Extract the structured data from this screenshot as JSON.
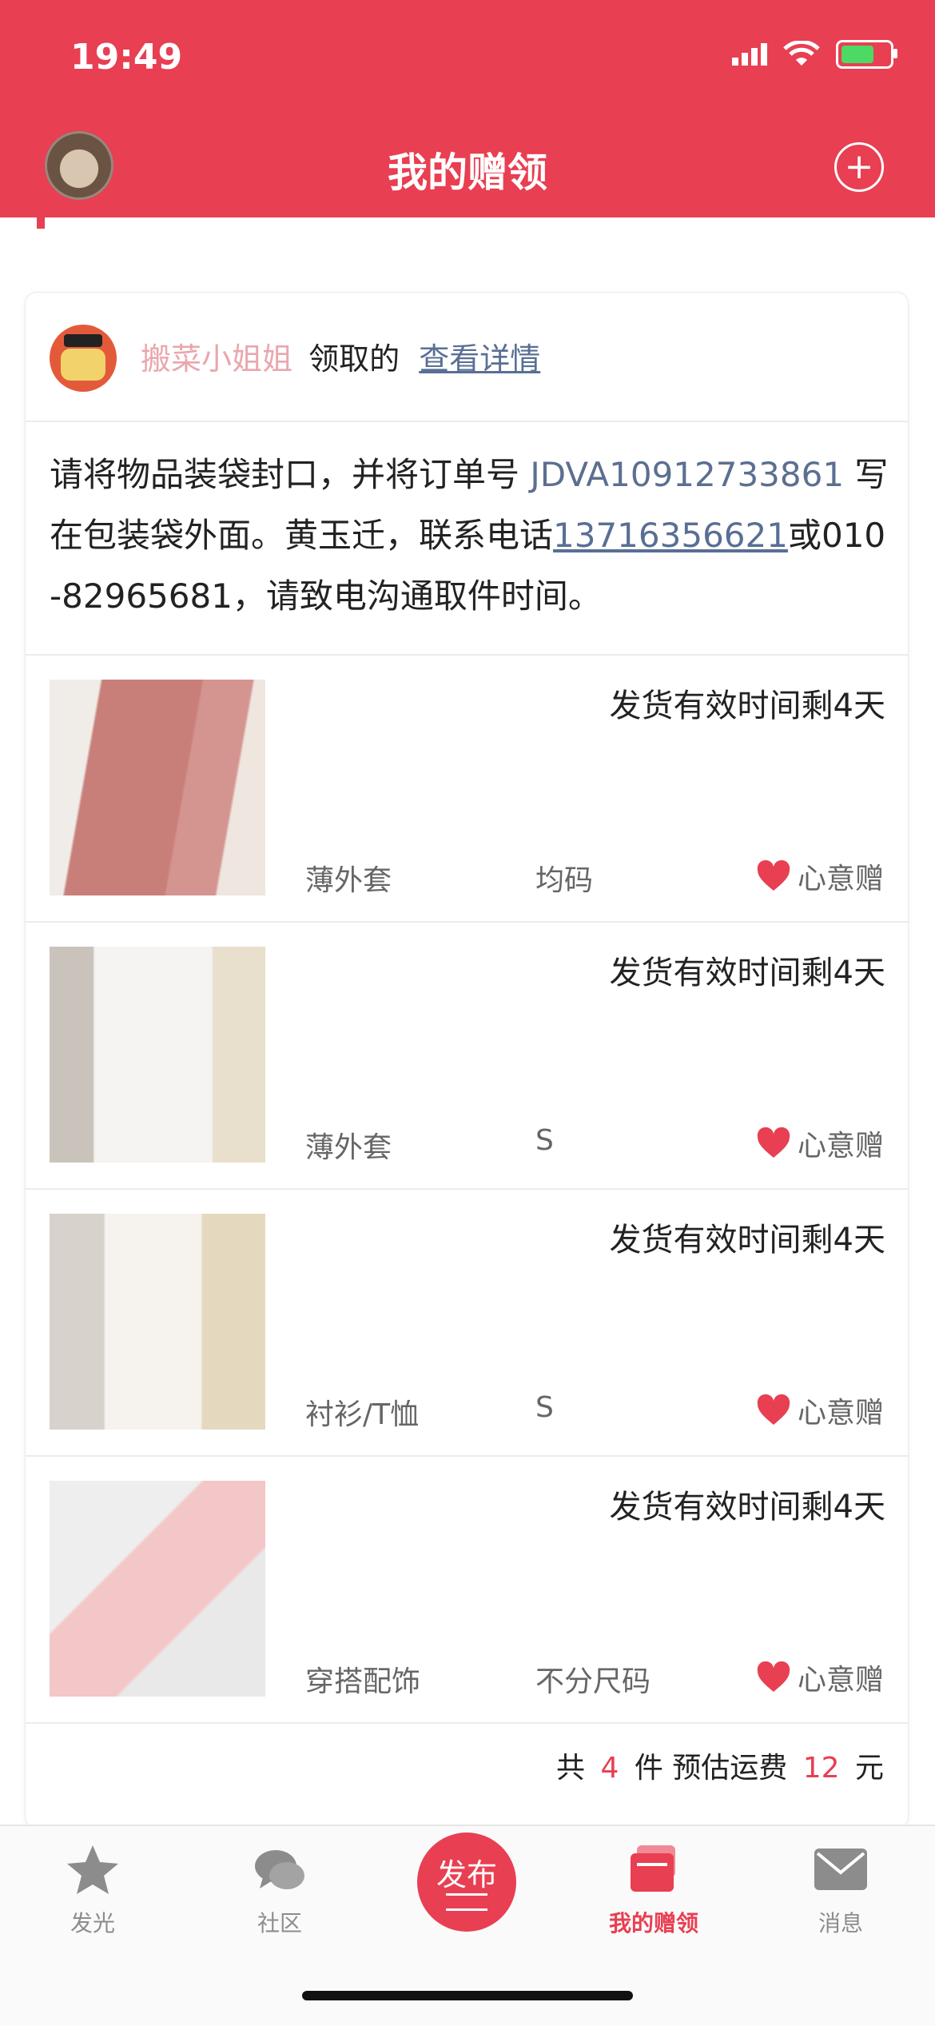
{
  "status_bar": {
    "time": "19:49"
  },
  "header": {
    "title": "我的赠领"
  },
  "card": {
    "giver_name": "搬菜小姐姐",
    "claim_text": "领取的",
    "detail_link": "查看详情",
    "notice": {
      "before_order": "请将物品装袋封口，并将订单号 ",
      "order_no": "JDVA10912733861",
      "after_order": " 写在包装袋外面。黄玉迁，联系电话",
      "phone": "13716356621",
      "after_phone": "或010-82965681，请致电沟通取件时间。"
    },
    "items": [
      {
        "ship_time": "发货有效时间剩4天",
        "category": "薄外套",
        "size": "均码",
        "tag": "心意赠"
      },
      {
        "ship_time": "发货有效时间剩4天",
        "category": "薄外套",
        "size": "S",
        "tag": "心意赠"
      },
      {
        "ship_time": "发货有效时间剩4天",
        "category": "衬衫/T恤",
        "size": "S",
        "tag": "心意赠"
      },
      {
        "ship_time": "发货有效时间剩4天",
        "category": "穿搭配饰",
        "size": "不分尺码",
        "tag": "心意赠"
      }
    ],
    "summary": {
      "prefix": "共",
      "count": "4",
      "mid": "件 预估运费",
      "fee": "12",
      "suffix": "元"
    }
  },
  "tabbar": {
    "tabs": [
      {
        "label": "发光",
        "icon": "star-icon"
      },
      {
        "label": "社区",
        "icon": "chat-bubbles-icon"
      },
      {
        "label": "发布",
        "icon": "publish-icon"
      },
      {
        "label": "我的赠领",
        "icon": "gift-cards-icon"
      },
      {
        "label": "消息",
        "icon": "mail-icon"
      }
    ]
  },
  "colors": {
    "accent": "#e83f52",
    "link": "#596f94",
    "giver": "#e9a7ad"
  }
}
